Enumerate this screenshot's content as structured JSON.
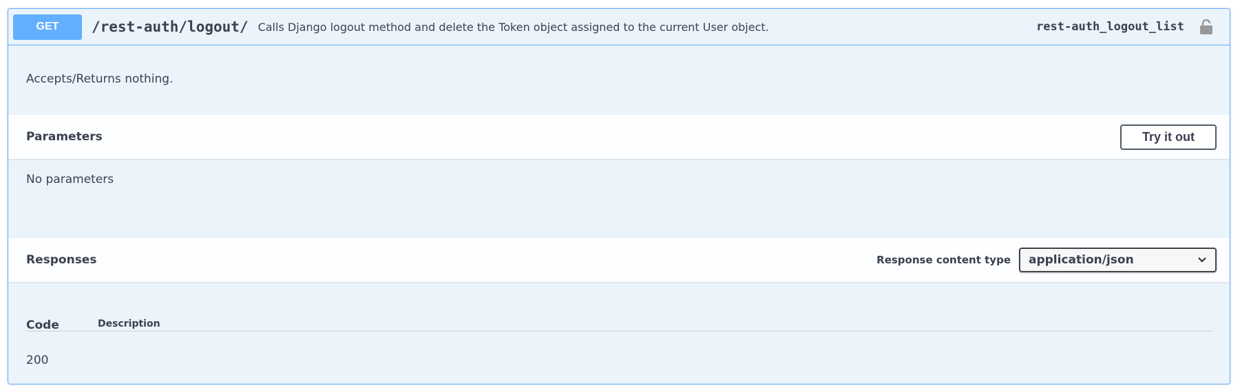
{
  "operation": {
    "method": "GET",
    "path": "/rest-auth/logout/",
    "summary": "Calls Django logout method and delete the Token object assigned to the current User object.",
    "operation_id": "rest-auth_logout_list",
    "lock_icon": "lock-open-icon",
    "description": "Accepts/Returns nothing."
  },
  "parameters": {
    "title": "Parameters",
    "try_button_label": "Try it out",
    "empty_text": "No parameters"
  },
  "responses": {
    "title": "Responses",
    "content_type_label": "Response content type",
    "content_type_value": "application/json",
    "columns": {
      "code": "Code",
      "description": "Description"
    },
    "rows": [
      {
        "code": "200",
        "description": ""
      }
    ]
  },
  "colors": {
    "get_accent": "#61affe",
    "block_background": "#ebf3fb",
    "text": "#3b4151"
  }
}
